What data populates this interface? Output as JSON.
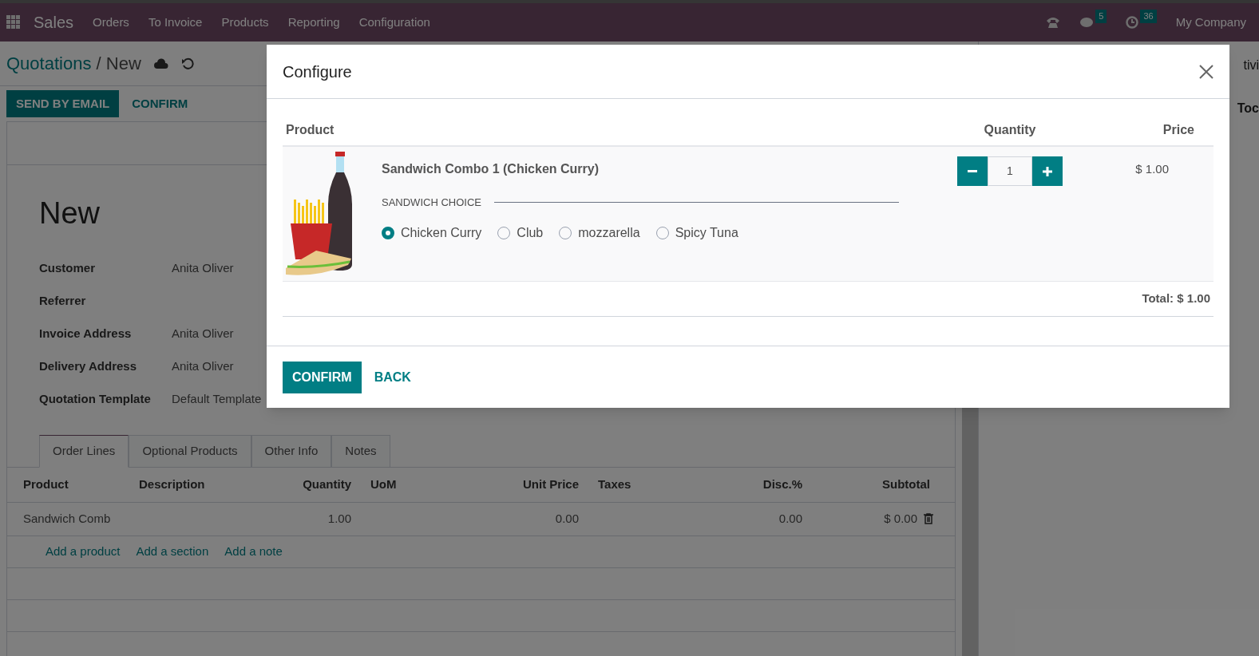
{
  "navbar": {
    "app": "Sales",
    "menu": [
      "Orders",
      "To Invoice",
      "Products",
      "Reporting",
      "Configuration"
    ],
    "messages_count": "5",
    "activities_count": "36",
    "company": "My Company"
  },
  "breadcrumb": {
    "parent": "Quotations",
    "separator": "/",
    "current": "New"
  },
  "actions": [
    "SEND BY EMAIL",
    "CONFIRM"
  ],
  "form": {
    "title": "New",
    "fields": [
      {
        "label": "Customer",
        "value": "Anita Oliver"
      },
      {
        "label": "Referrer"
      },
      {
        "label": "Invoice Address",
        "value": "Anita Oliver"
      },
      {
        "label": "Delivery Address",
        "value": "Anita Oliver"
      },
      {
        "label": "Quotation Template",
        "value": "Default Template"
      }
    ]
  },
  "tabs": [
    {
      "label": "Order Lines",
      "selected": true
    },
    {
      "label": "Optional Products",
      "selected": false
    },
    {
      "label": "Other Info",
      "selected": false
    },
    {
      "label": "Notes",
      "selected": false
    }
  ],
  "order_table": {
    "columns": [
      "Product",
      "Description",
      "Quantity",
      "UoM",
      "Unit Price",
      "Taxes",
      "Disc.%",
      "Subtotal"
    ],
    "rows": [
      {
        "product": "Sandwich Comb",
        "quantity": "1.00",
        "unit_price": "0.00",
        "discount": "0.00",
        "subtotal": "$ 0.00"
      }
    ],
    "links": [
      "Add a product",
      "Add a section",
      "Add a note"
    ]
  },
  "chatter_fragments": [
    "tivi",
    "Toc"
  ],
  "dialog": {
    "title": "Configure",
    "columns": [
      "Product",
      "Quantity",
      "Price"
    ],
    "product": {
      "name": "Sandwich Combo 1 (Chicken Curry)",
      "attribute": "SANDWICH CHOICE",
      "options": [
        {
          "label": "Chicken Curry",
          "selected": true
        },
        {
          "label": "Club",
          "selected": false
        },
        {
          "label": "mozzarella",
          "selected": false
        },
        {
          "label": "Spicy Tuna",
          "selected": false
        }
      ],
      "quantity": "1",
      "price": "$ 1.00"
    },
    "total": "Total: $ 1.00",
    "buttons": [
      "CONFIRM",
      "BACK"
    ]
  }
}
